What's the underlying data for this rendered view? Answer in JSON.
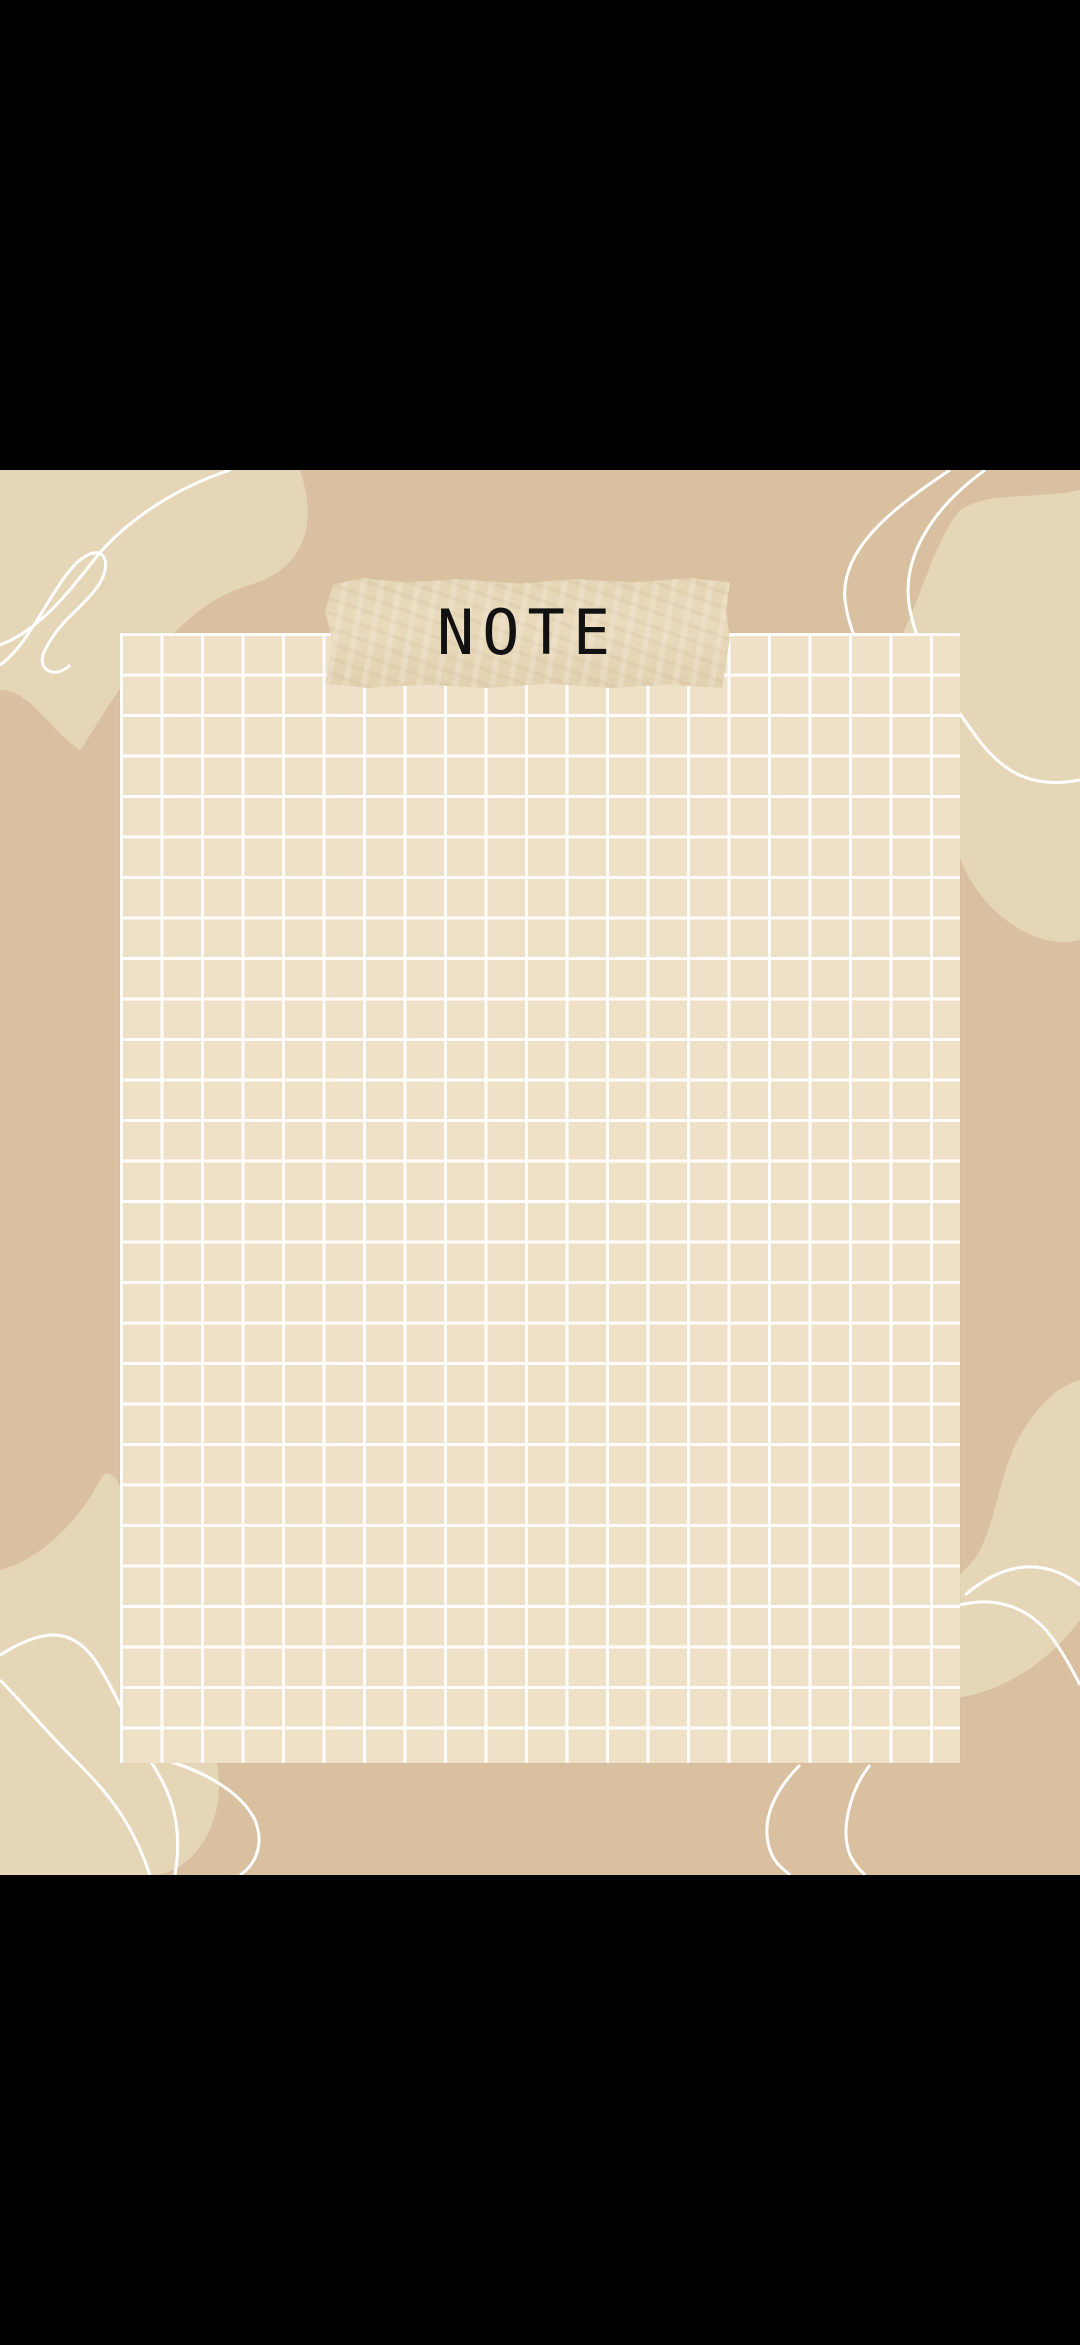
{
  "note": {
    "title": "NOTE"
  },
  "colors": {
    "background_black": "#000000",
    "wallpaper_tan": "#d8c0a0",
    "blob_cream": "#e6d6b8",
    "paper": "#efe1c8",
    "grid_line": "#ffffff",
    "tape": "#e5d6b6",
    "text": "#111111"
  },
  "icons": {
    "decoration": "abstract-line-swirls"
  }
}
